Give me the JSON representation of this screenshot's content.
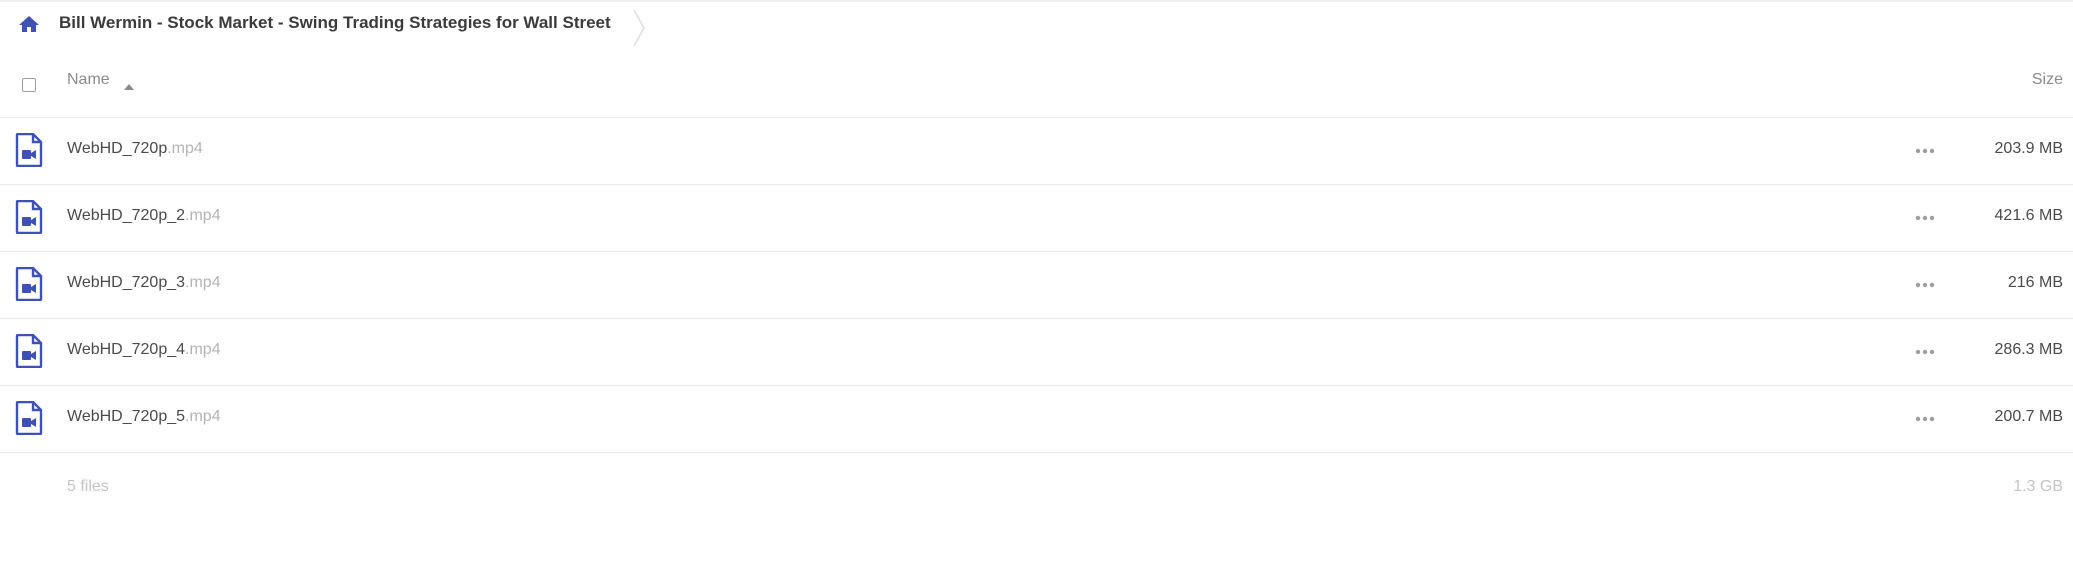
{
  "breadcrumb": {
    "home_icon": "home-icon",
    "folder_title": "Bill Wermin - Stock Market - Swing Trading Strategies for Wall Street"
  },
  "table_header": {
    "name_label": "Name",
    "size_label": "Size",
    "sort_icon": "sort-ascending-icon"
  },
  "files": [
    {
      "base": "WebHD_720p",
      "ext": ".mp4",
      "size": "203.9 MB",
      "icon": "video-file-icon"
    },
    {
      "base": "WebHD_720p_2",
      "ext": ".mp4",
      "size": "421.6 MB",
      "icon": "video-file-icon"
    },
    {
      "base": "WebHD_720p_3",
      "ext": ".mp4",
      "size": "216 MB",
      "icon": "video-file-icon"
    },
    {
      "base": "WebHD_720p_4",
      "ext": ".mp4",
      "size": "286.3 MB",
      "icon": "video-file-icon"
    },
    {
      "base": "WebHD_720p_5",
      "ext": ".mp4",
      "size": "200.7 MB",
      "icon": "video-file-icon"
    }
  ],
  "footer": {
    "count": "5 files",
    "total_size": "1.3 GB"
  },
  "colors": {
    "accent": "#3f51b5",
    "muted_text": "#8b8b8b",
    "divider": "#ececec"
  }
}
